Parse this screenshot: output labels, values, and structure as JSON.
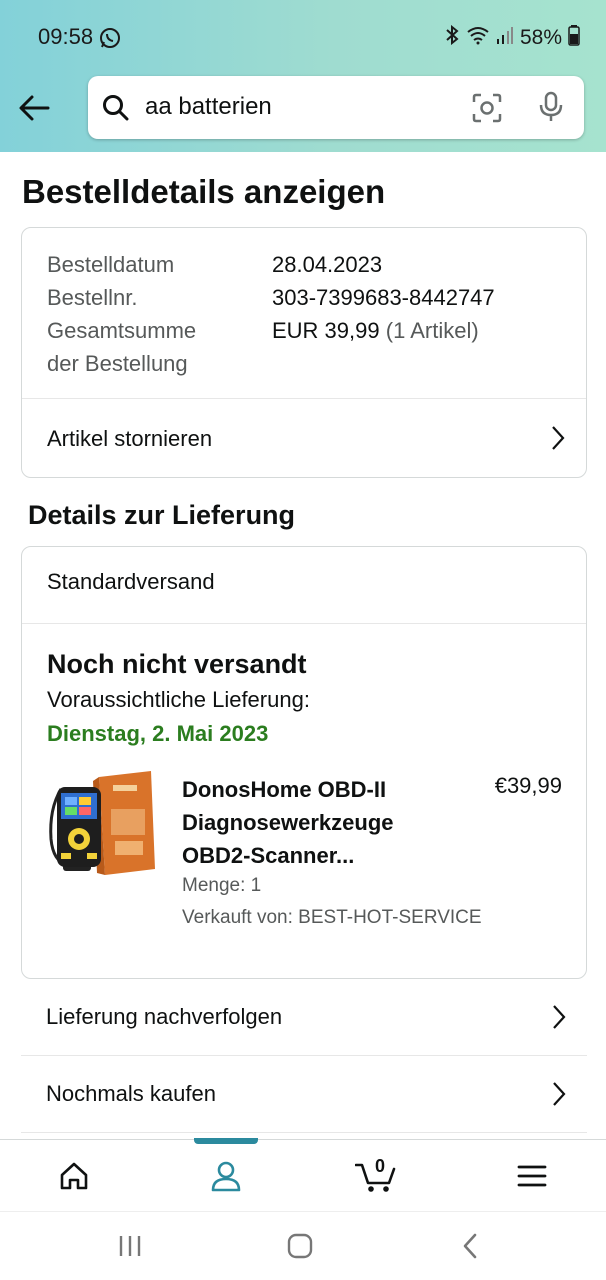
{
  "status_bar": {
    "time": "09:58",
    "battery": "58%"
  },
  "search": {
    "value": "aa batterien"
  },
  "page": {
    "title": "Bestelldetails anzeigen"
  },
  "order": {
    "date_label": "Bestelldatum",
    "date_value": "28.04.2023",
    "number_label": "Bestellnr.",
    "number_value": "303-7399683-8442747",
    "total_label_line1": "Gesamtsumme",
    "total_label_line2": "der Bestellung",
    "total_value": "EUR 39,99",
    "total_count": "(1 Artikel)",
    "cancel_label": "Artikel stornieren"
  },
  "delivery": {
    "section_title": "Details zur Lieferung",
    "shipping_method": "Standardversand",
    "status": "Noch nicht versandt",
    "eta_label": "Voraussichtliche Lieferung:",
    "eta_date": "Dienstag, 2. Mai 2023",
    "item": {
      "name_line1": "DonosHome OBD-II",
      "name_line2": "Diagnosewerkzeuge",
      "name_line3": "OBD2-Scanner...",
      "price": "€39,99",
      "quantity": "Menge: 1",
      "seller": "Verkauft von: BEST-HOT-SERVICE"
    }
  },
  "actions": [
    {
      "label": "Lieferung nachverfolgen"
    },
    {
      "label": "Nochmals kaufen"
    }
  ],
  "tabbar": {
    "cart_count": "0"
  },
  "colors": {
    "accent": "#2b8a9e",
    "eta_green": "#2b7d1f",
    "header_start": "#83d1d9",
    "header_end": "#a6e3cf"
  }
}
